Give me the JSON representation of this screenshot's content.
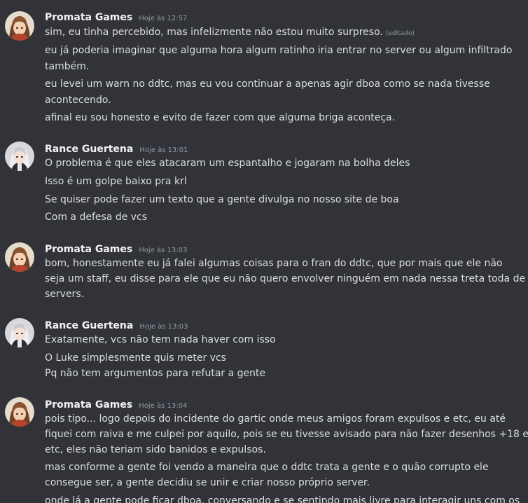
{
  "messages": [
    {
      "author": "Promata Games",
      "timestamp": "Hoje às 12:57",
      "avatar_icon": "anime-avatar-brown-hair-icon",
      "lines": [
        "sim, eu tinha percebido, mas infelizmente não estou muito surpreso.",
        "eu já poderia imaginar que alguma hora algum ratinho iria entrar no server ou algum infiltrado",
        "também.",
        "eu levei um warn no ddtc, mas eu vou continuar a apenas agir dboa como se nada tivesse",
        "acontecendo.",
        "afinal eu sou honesto e evito de fazer com que alguma briga aconteça."
      ],
      "edited_label": "(editado)"
    },
    {
      "author": "Rance Guertena",
      "timestamp": "Hoje às 13:01",
      "avatar_icon": "anime-avatar-white-hair-icon",
      "lines": [
        "O problema é que eles atacaram um espantalho e jogaram na bolha deles",
        "Isso é um golpe baixo pra krl",
        "Se quiser pode fazer um texto que a gente divulga no nosso site de boa",
        "Com a defesa de vcs"
      ]
    },
    {
      "author": "Promata Games",
      "timestamp": "Hoje às 13:03",
      "avatar_icon": "anime-avatar-brown-hair-icon",
      "lines": [
        "bom, honestamente eu já falei algumas coisas para o fran do ddtc, que por mais que ele não",
        "seja um staff, eu disse para ele que eu não quero envolver ninguém em nada nessa treta toda de",
        "servers."
      ]
    },
    {
      "author": "Rance Guertena",
      "timestamp": "Hoje às 13:03",
      "avatar_icon": "anime-avatar-white-hair-icon",
      "lines": [
        "Exatamente, vcs não tem nada haver com isso",
        "O Luke simplesmente quis meter vcs",
        "Pq não tem argumentos para refutar a gente"
      ]
    },
    {
      "author": "Promata Games",
      "timestamp": "Hoje às 13:04",
      "avatar_icon": "anime-avatar-brown-hair-icon",
      "lines": [
        "pois tipo... logo depois do incidente do gartic onde meus amigos foram expulsos e etc, eu até",
        "fiquei com raiva e me culpei por aquilo, pois se eu tivesse avisado para não fazer desenhos +18 e",
        "etc, eles não teriam sido banidos e expulsos.",
        "mas conforme a gente foi vendo a maneira que o ddtc trata a gente e o quão corrupto ele",
        "consegue ser, a gente decidiu se unir e criar nosso próprio server.",
        "onde lá a gente pode ficar dboa, conversando e se sentindo mais livre para interagir uns com os"
      ]
    }
  ]
}
